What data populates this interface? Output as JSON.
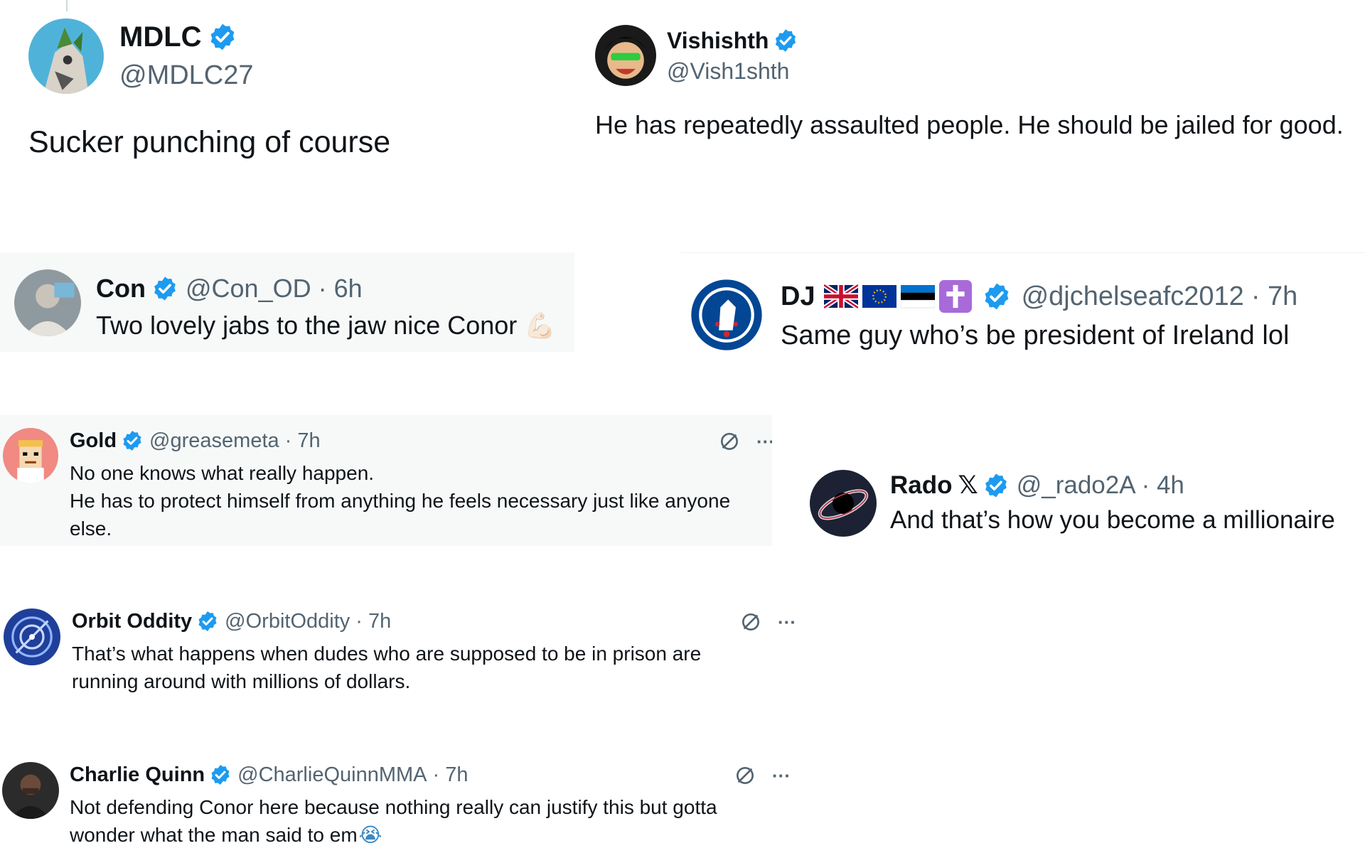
{
  "colors": {
    "verified": "#1d9bf0",
    "text": "#0f1419",
    "muted": "#536471",
    "panel_bg": "#f7f9f9"
  },
  "tweets": [
    {
      "name": "MDLC",
      "handle": "@MDLC27",
      "text": "Sucker punching of course",
      "avatar_icon": "avatar-wolf-icon"
    },
    {
      "name": "Vishishth",
      "handle": "@Vish1shth",
      "text": "He has repeatedly assaulted people. He should be jailed for good.",
      "avatar_icon": "avatar-cartoon-face-icon"
    },
    {
      "name": "Con",
      "handle": "@Con_OD",
      "time": "· 6h",
      "text": "Two lovely jabs to the jaw nice Conor",
      "emoji": "💪🏻",
      "avatar_icon": "avatar-person-icon"
    },
    {
      "name": "DJ",
      "handle": "@djchelseafc2012",
      "time": "· 7h",
      "text": "Same guy who’s be president of Ireland lol",
      "flags": [
        "uk-flag-icon",
        "eu-flag-icon",
        "estonia-flag-icon",
        "cross-icon"
      ],
      "avatar_icon": "avatar-chelsea-crest-icon"
    },
    {
      "name": "Gold",
      "handle": "@greasemeta",
      "time": "· 7h",
      "lines": [
        "No one knows what really happen.",
        "He has to protect himself from anything he feels necessary just like anyone",
        "else."
      ],
      "avatar_icon": "avatar-pixel-character-icon"
    },
    {
      "name": "Rado",
      "name_suffix": "𝕏",
      "handle": "@_rado2A",
      "time": "· 4h",
      "text": "And that’s how you become a millionaire",
      "avatar_icon": "avatar-black-hole-icon"
    },
    {
      "name": "Orbit Oddity",
      "handle": "@OrbitOddity",
      "time": "· 7h",
      "lines": [
        "That’s what happens when dudes who are supposed to be in prison are",
        "running around with millions of dollars."
      ],
      "avatar_icon": "avatar-orbit-icon"
    },
    {
      "name": "Charlie Quinn",
      "handle": "@CharlieQuinnMMA",
      "time": "· 7h",
      "lines": [
        "Not defending Conor here because nothing really can justify this but gotta",
        "wonder what the man said to em"
      ],
      "emoji": "😭",
      "avatar_icon": "avatar-man-icon"
    }
  ],
  "actions": {
    "more_label": "···",
    "grok_icon": "grok-slash-circle-icon"
  }
}
